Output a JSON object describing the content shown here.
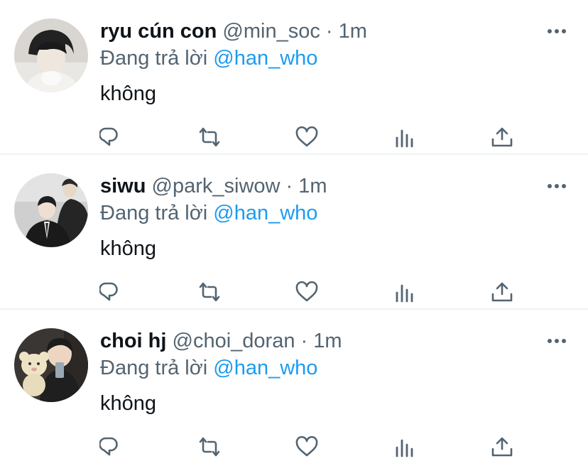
{
  "tweets": [
    {
      "name": "ryu cún con",
      "handle": "@min_soc",
      "separator": "·",
      "time": "1m",
      "reply_prefix": "Đang trả lời",
      "reply_to": "@han_who",
      "text": "không"
    },
    {
      "name": "siwu",
      "handle": "@park_siwow",
      "separator": "·",
      "time": "1m",
      "reply_prefix": "Đang trả lời",
      "reply_to": "@han_who",
      "text": "không"
    },
    {
      "name": "choi hj",
      "handle": "@choi_doran",
      "separator": "·",
      "time": "1m",
      "reply_prefix": "Đang trả lời",
      "reply_to": "@han_who",
      "text": "không"
    }
  ],
  "action_icons": [
    "reply-icon",
    "retweet-icon",
    "like-icon",
    "views-icon",
    "share-icon"
  ],
  "colors": {
    "text": "#0f1419",
    "secondary": "#536471",
    "accent": "#1d9bf0",
    "divider": "#eff3f4"
  }
}
